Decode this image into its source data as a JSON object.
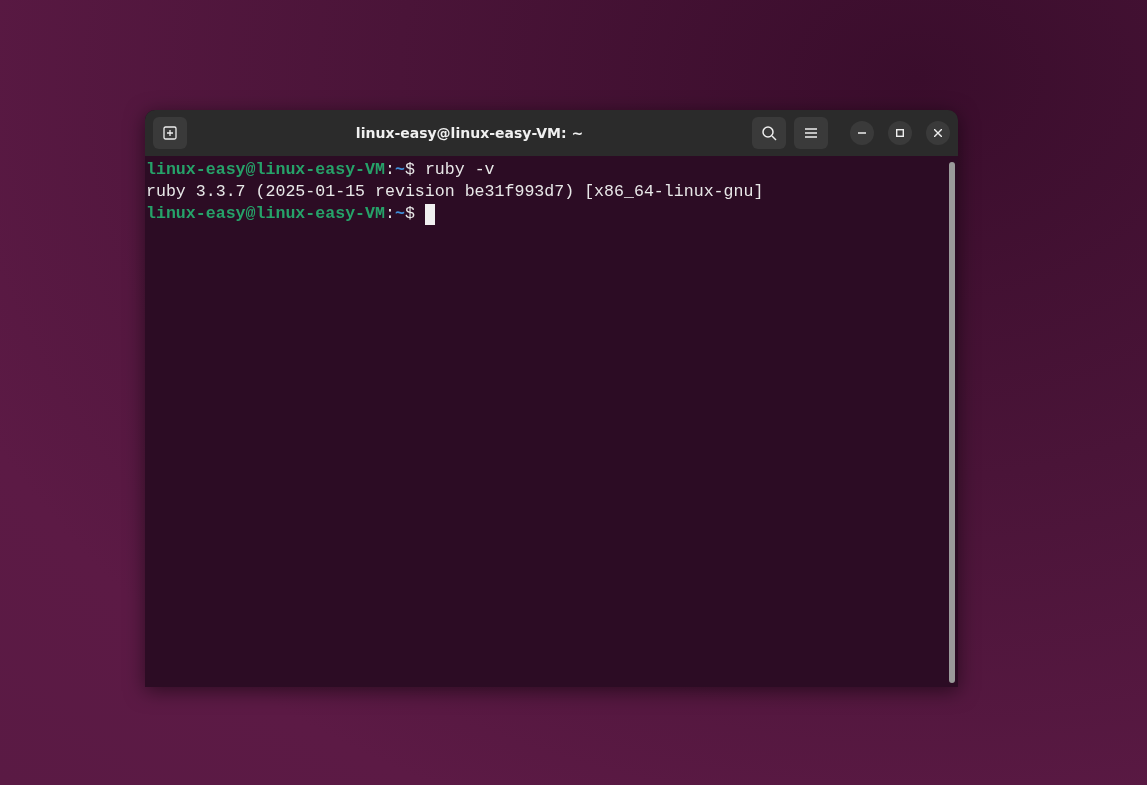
{
  "window": {
    "title": "linux-easy@linux-easy-VM: ~"
  },
  "terminal": {
    "lines": [
      {
        "kind": "prompt",
        "user_host": "linux-easy@linux-easy-VM",
        "separator": ":",
        "path": "~",
        "symbol": "$",
        "command": "ruby -v",
        "cursor": false
      },
      {
        "kind": "output",
        "text": "ruby 3.3.7 (2025-01-15 revision be31f993d7) [x86_64-linux-gnu]"
      },
      {
        "kind": "prompt",
        "user_host": "linux-easy@linux-easy-VM",
        "separator": ":",
        "path": "~",
        "symbol": "$",
        "cursor": true
      }
    ]
  }
}
